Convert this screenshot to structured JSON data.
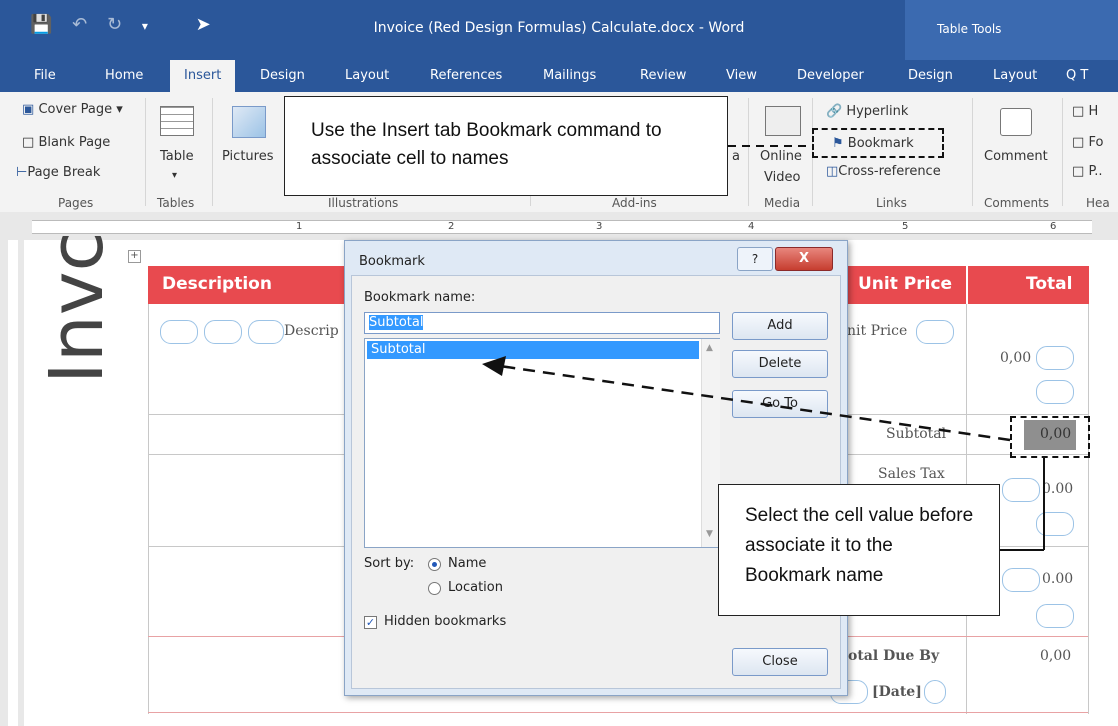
{
  "title_bar": {
    "doc_title": "Invoice (Red Design Formulas) Calculate.docx - Word",
    "context_label": "Table Tools"
  },
  "tabs": [
    "File",
    "Home",
    "Insert",
    "Design",
    "Layout",
    "References",
    "Mailings",
    "Review",
    "View",
    "Developer",
    "Design",
    "Layout",
    "Q T"
  ],
  "ribbon": {
    "pages": {
      "cover_page": "Cover Page ▾",
      "blank_page": "Blank Page",
      "page_break": "Page Break",
      "group": "Pages"
    },
    "tables": {
      "table": "Table",
      "group": "Tables"
    },
    "illustrations": {
      "pictures": "Pictures",
      "group": "Illustrations"
    },
    "addins": {
      "group": "Add-ins",
      "fragment": "a"
    },
    "media": {
      "online_video": "Online",
      "online_video2": "Video",
      "group": "Media"
    },
    "links": {
      "hyperlink": "Hyperlink",
      "bookmark": "Bookmark",
      "cross_reference": "Cross-reference",
      "group": "Links"
    },
    "comments": {
      "comment": "Comment",
      "group": "Comments"
    },
    "header_footer": {
      "h": "H",
      "f": "Fo",
      "p": "P..",
      "group": "Hea"
    }
  },
  "ruler": {
    "marks": [
      "1",
      "2",
      "3",
      "4",
      "5",
      "6"
    ]
  },
  "document": {
    "big_text": "Invc",
    "headers": {
      "description": "Description",
      "unit_price": "Unit Price",
      "total": "Total"
    },
    "cells": {
      "descrip": "Descrip",
      "nit_price": "nit Price",
      "row1_total": "0,00",
      "subtotal_label": "Subtotal",
      "subtotal_value": "0,00",
      "sales_tax": "Sales Tax",
      "sales_tax_value": "0.00",
      "row3_value": "0.00",
      "total_due": "otal Due By",
      "date": "[Date]",
      "total_due_value": "0,00"
    }
  },
  "dialog": {
    "title": "Bookmark",
    "help": "?",
    "close_x": "X",
    "name_label": "Bookmark name:",
    "name_value": "Subtotal",
    "list_items": [
      "Subtotal"
    ],
    "buttons": {
      "add": "Add",
      "delete": "Delete",
      "goto": "Go To",
      "close": "Close"
    },
    "sort_label": "Sort by:",
    "sort_name": "Name",
    "sort_location": "Location",
    "hidden_label": "Hidden bookmarks"
  },
  "callouts": {
    "insert_tab": "Use the Insert tab Bookmark command to associate cell to names",
    "select_cell": "Select the cell value before associate it to the Bookmark name"
  }
}
